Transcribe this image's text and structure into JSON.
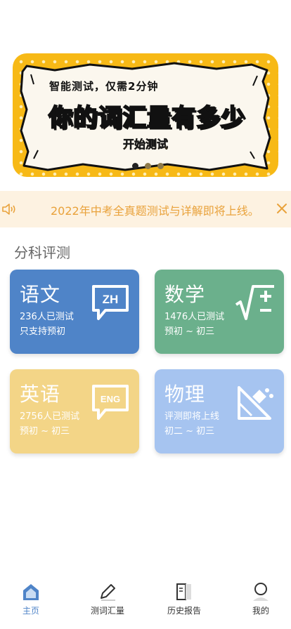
{
  "banner": {
    "tagline": "智能测试，仅需2分钟",
    "headline": "你的词汇量有多少",
    "start_label": "开始测试",
    "page_count": 3,
    "active_page": 1
  },
  "notice": {
    "text": "2022年中考全真题测试与详解即将上线。"
  },
  "section": {
    "title": "分科评测"
  },
  "subjects": [
    {
      "name": "语文",
      "count": "236人已测试",
      "range": "只支持预初",
      "icon_text": "ZH",
      "color": "#4f84c8"
    },
    {
      "name": "数学",
      "count": "1476人已测试",
      "range": "预初 ~ 初三",
      "color": "#6bb08c"
    },
    {
      "name": "英语",
      "count": "2756人已测试",
      "range": "预初 ~ 初三",
      "icon_text": "ENG",
      "color": "#f3d587"
    },
    {
      "name": "物理",
      "count": "评测即将上线",
      "range": "初二 ~ 初三",
      "color": "#a6c4f0"
    }
  ],
  "tabs": [
    {
      "label": "主页",
      "icon": "home-icon",
      "active": true
    },
    {
      "label": "测词汇量",
      "icon": "pencil-icon",
      "active": false
    },
    {
      "label": "历史报告",
      "icon": "book-icon",
      "active": false
    },
    {
      "label": "我的",
      "icon": "user-icon",
      "active": false
    }
  ],
  "colors": {
    "accent": "#4f84c8",
    "banner": "#f7b916",
    "notice_text": "#e9a23b",
    "notice_bg": "#fdf2e1"
  }
}
